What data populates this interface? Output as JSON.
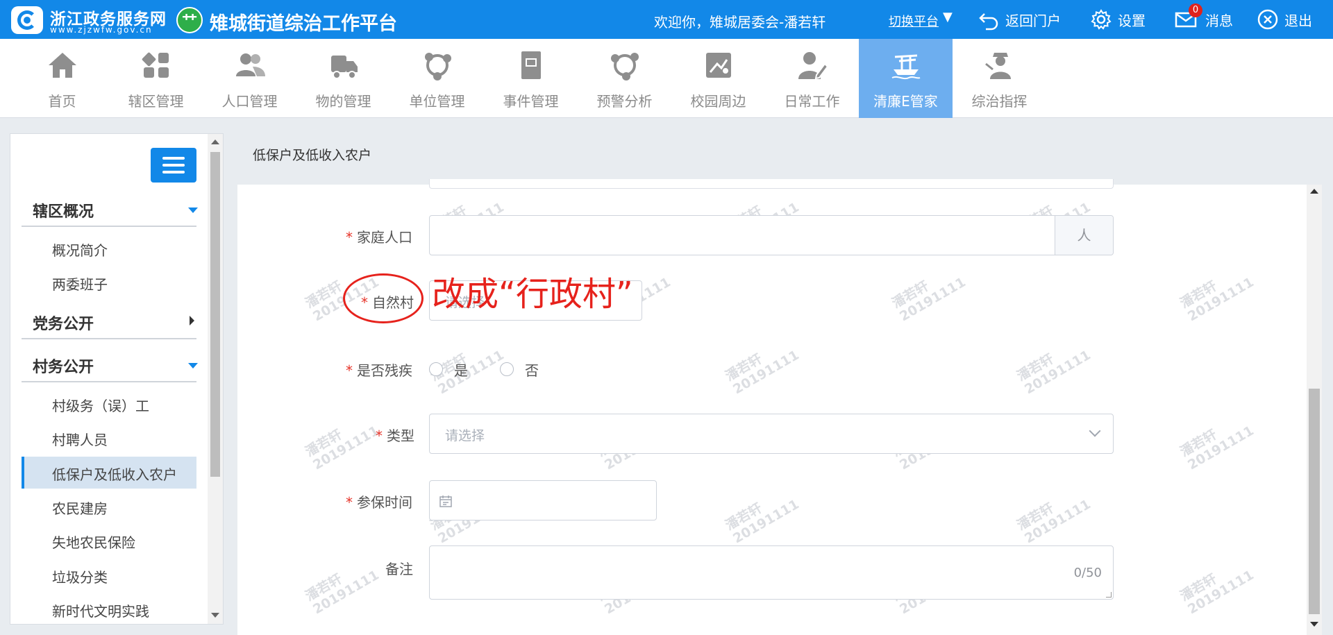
{
  "topbar": {
    "brand_name": "浙江政务服务网",
    "brand_url": "www.zjzwfw.gov.cn",
    "platform_title": "雉城街道综治工作平台",
    "welcome": "欢迎你，雉城居委会-潘若轩",
    "switch_platform": "切换平台",
    "back_portal": "返回门户",
    "settings": "设置",
    "messages": "消息",
    "message_count": "0",
    "logout": "退出"
  },
  "nav": {
    "items": [
      {
        "label": "首页",
        "icon": "home-icon"
      },
      {
        "label": "辖区管理",
        "icon": "grid-icon"
      },
      {
        "label": "人口管理",
        "icon": "people-icon"
      },
      {
        "label": "物的管理",
        "icon": "truck-icon"
      },
      {
        "label": "单位管理",
        "icon": "network-icon"
      },
      {
        "label": "事件管理",
        "icon": "book-icon"
      },
      {
        "label": "预警分析",
        "icon": "network-icon"
      },
      {
        "label": "校园周边",
        "icon": "campus-icon"
      },
      {
        "label": "日常工作",
        "icon": "user-edit-icon"
      },
      {
        "label": "清廉E管家",
        "icon": "boat-icon"
      },
      {
        "label": "综治指挥",
        "icon": "officer-icon"
      }
    ],
    "active_index": 9
  },
  "sidebar": {
    "sections": [
      {
        "title": "辖区概况",
        "items": [
          "概况简介",
          "两委班子"
        ]
      },
      {
        "title": "党务公开",
        "items": []
      },
      {
        "title": "村务公开",
        "items": [
          "村级务（误）工",
          "村聘人员",
          "低保户及低收入农户",
          "农民建房",
          "失地农民保险",
          "垃圾分类",
          "新时代文明实践"
        ]
      }
    ],
    "active_item": "低保户及低收入农户"
  },
  "main": {
    "breadcrumb": "低保户及低收入农户",
    "form": {
      "household_label": "家庭人口",
      "household_unit": "人",
      "village_label": "自然村",
      "village_placeholder": "请选择",
      "disabled_label": "是否残疾",
      "disabled_yes": "是",
      "disabled_no": "否",
      "type_label": "类型",
      "type_placeholder": "请选择",
      "insured_label": "参保时间",
      "remark_label": "备注",
      "remark_counter": "0/50",
      "required_mark": "*"
    },
    "annotation": "改成“行政村”",
    "watermark": {
      "name": "潘若轩",
      "code": "20191111"
    }
  },
  "colors": {
    "primary": "#1288e8",
    "nav_active": "#6daeef",
    "annotation": "#e6221c",
    "required": "#e6342a"
  }
}
